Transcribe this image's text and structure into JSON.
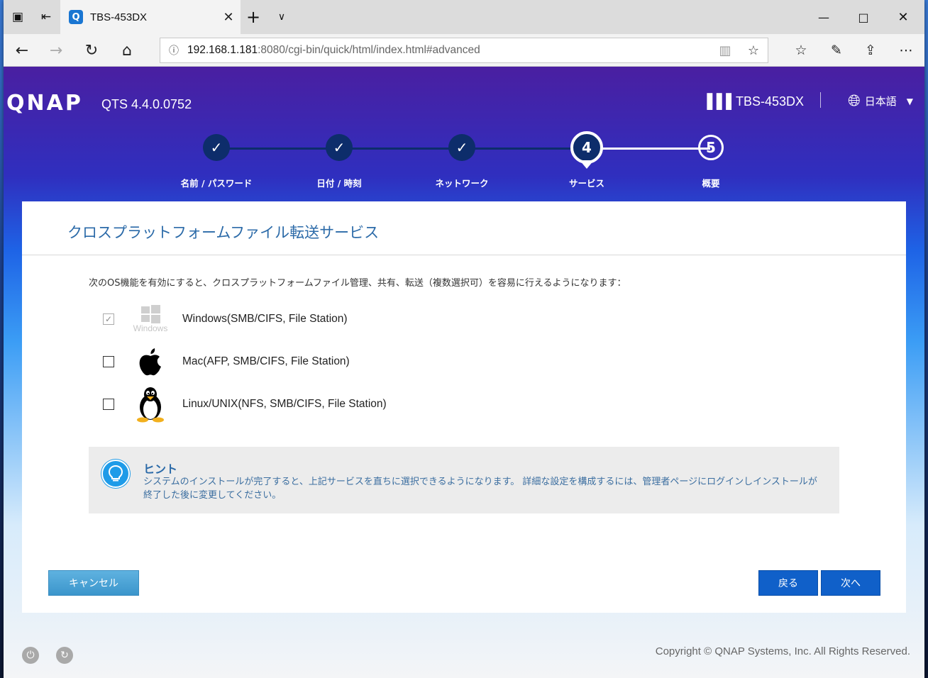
{
  "browser": {
    "tab_title": "TBS-453DX",
    "tab_favicon": "Q",
    "url_host": "192.168.1.181",
    "url_rest": ":8080/cgi-bin/quick/html/index.html#advanced"
  },
  "header": {
    "logo": "QNAP",
    "version": "QTS 4.4.0.0752",
    "model": "TBS-453DX",
    "language": "日本語"
  },
  "steps": [
    {
      "number": "1",
      "label": "名前 / パスワード",
      "state": "done"
    },
    {
      "number": "2",
      "label": "日付 / 時刻",
      "state": "done"
    },
    {
      "number": "3",
      "label": "ネットワーク",
      "state": "done"
    },
    {
      "number": "4",
      "label": "サービス",
      "state": "current"
    },
    {
      "number": "5",
      "label": "概要",
      "state": "pending"
    }
  ],
  "card": {
    "title": "クロスプラットフォームファイル転送サービス",
    "description": "次のOS機能を有効にすると、クロスプラットフォームファイル管理、共有、転送（複数選択可）を容易に行えるようになります：",
    "options": [
      {
        "label": "Windows(SMB/CIFS, File Station)",
        "checked": true,
        "disabled": true,
        "logo_text": "Windows"
      },
      {
        "label": "Mac(AFP, SMB/CIFS, File Station)",
        "checked": false,
        "disabled": false
      },
      {
        "label": "Linux/UNIX(NFS, SMB/CIFS, File Station)",
        "checked": false,
        "disabled": false
      }
    ],
    "hint": {
      "title": "ヒント",
      "text": "システムのインストールが完了すると、上記サービスを直ちに選択できるようになります。 詳細な設定を構成するには、管理者ページにログインしインストールが終了した後に変更してください。"
    },
    "buttons": {
      "cancel": "キャンセル",
      "back": "戻る",
      "next": "次へ"
    }
  },
  "footer": {
    "copyright": "Copyright © QNAP Systems, Inc. All Rights Reserved."
  },
  "colors": {
    "accent": "#1060c9",
    "title": "#2b6aa8",
    "step_done": "#0d2d6b"
  }
}
